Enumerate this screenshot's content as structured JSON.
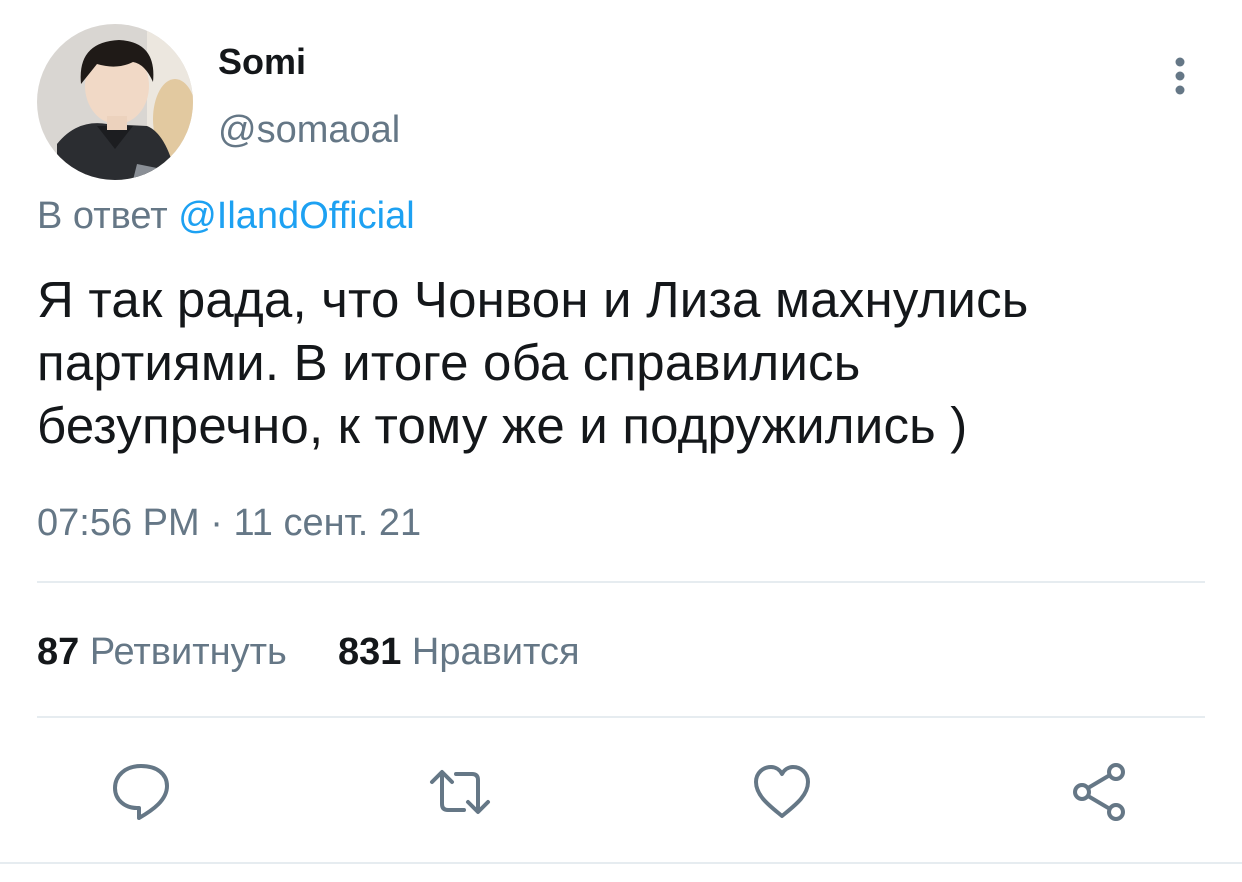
{
  "tweet": {
    "author": {
      "display_name": "Somi",
      "handle": "@somaoal",
      "avatar_icon": "user-avatar-photo"
    },
    "reply_to": {
      "prefix": "В ответ",
      "mention": "@IlandOfficial"
    },
    "text_lines": [
      "Я так рада, что Чонвон и Лиза махнулись",
      "партиями. В итоге оба справились",
      "безупречно, к тому же и подружились )"
    ],
    "time": "07:56 PM",
    "separator": "·",
    "date": "11 сент. 21",
    "stats": {
      "retweets_count": "87",
      "retweets_label": "Ретвитнуть",
      "likes_count": "831",
      "likes_label": "Нравится"
    },
    "actions": [
      {
        "icon": "reply-icon"
      },
      {
        "icon": "retweet-icon"
      },
      {
        "icon": "like-heart-icon"
      },
      {
        "icon": "share-icon"
      }
    ],
    "menu_icon": "more-vertical-icon"
  },
  "colors": {
    "text_primary": "#14171a",
    "text_secondary": "#657786",
    "link": "#1da1f2",
    "divider": "#e6ecf0",
    "icon": "#657786"
  }
}
